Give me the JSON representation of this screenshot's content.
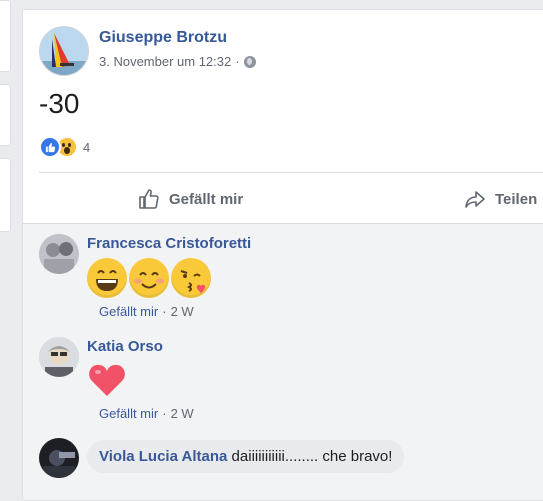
{
  "post": {
    "author": "Giuseppe Brotzu",
    "timestamp": "3. November um 12:32",
    "separator": "·",
    "text": "-30",
    "reaction_count": "4",
    "actions": {
      "like": "Gefällt mir",
      "share": "Teilen"
    }
  },
  "comments": [
    {
      "author": "Francesca Cristoforetti",
      "emojis": [
        "grinning-face",
        "smiling-face",
        "kissing-face"
      ],
      "like_label": "Gefällt mir",
      "separator": "·",
      "time": "2 W"
    },
    {
      "author": "Katia Orso",
      "emojis": [
        "red-heart"
      ],
      "like_label": "Gefällt mir",
      "separator": "·",
      "time": "2 W"
    },
    {
      "author": "Viola Lucia Altana",
      "text": "daiiiiiiiiiii........ che bravo!"
    }
  ],
  "colors": {
    "link_blue": "#385898",
    "like_blue": "#3578e5",
    "wow_yellow": "#f7c23b",
    "heart_red": "#f25268"
  }
}
